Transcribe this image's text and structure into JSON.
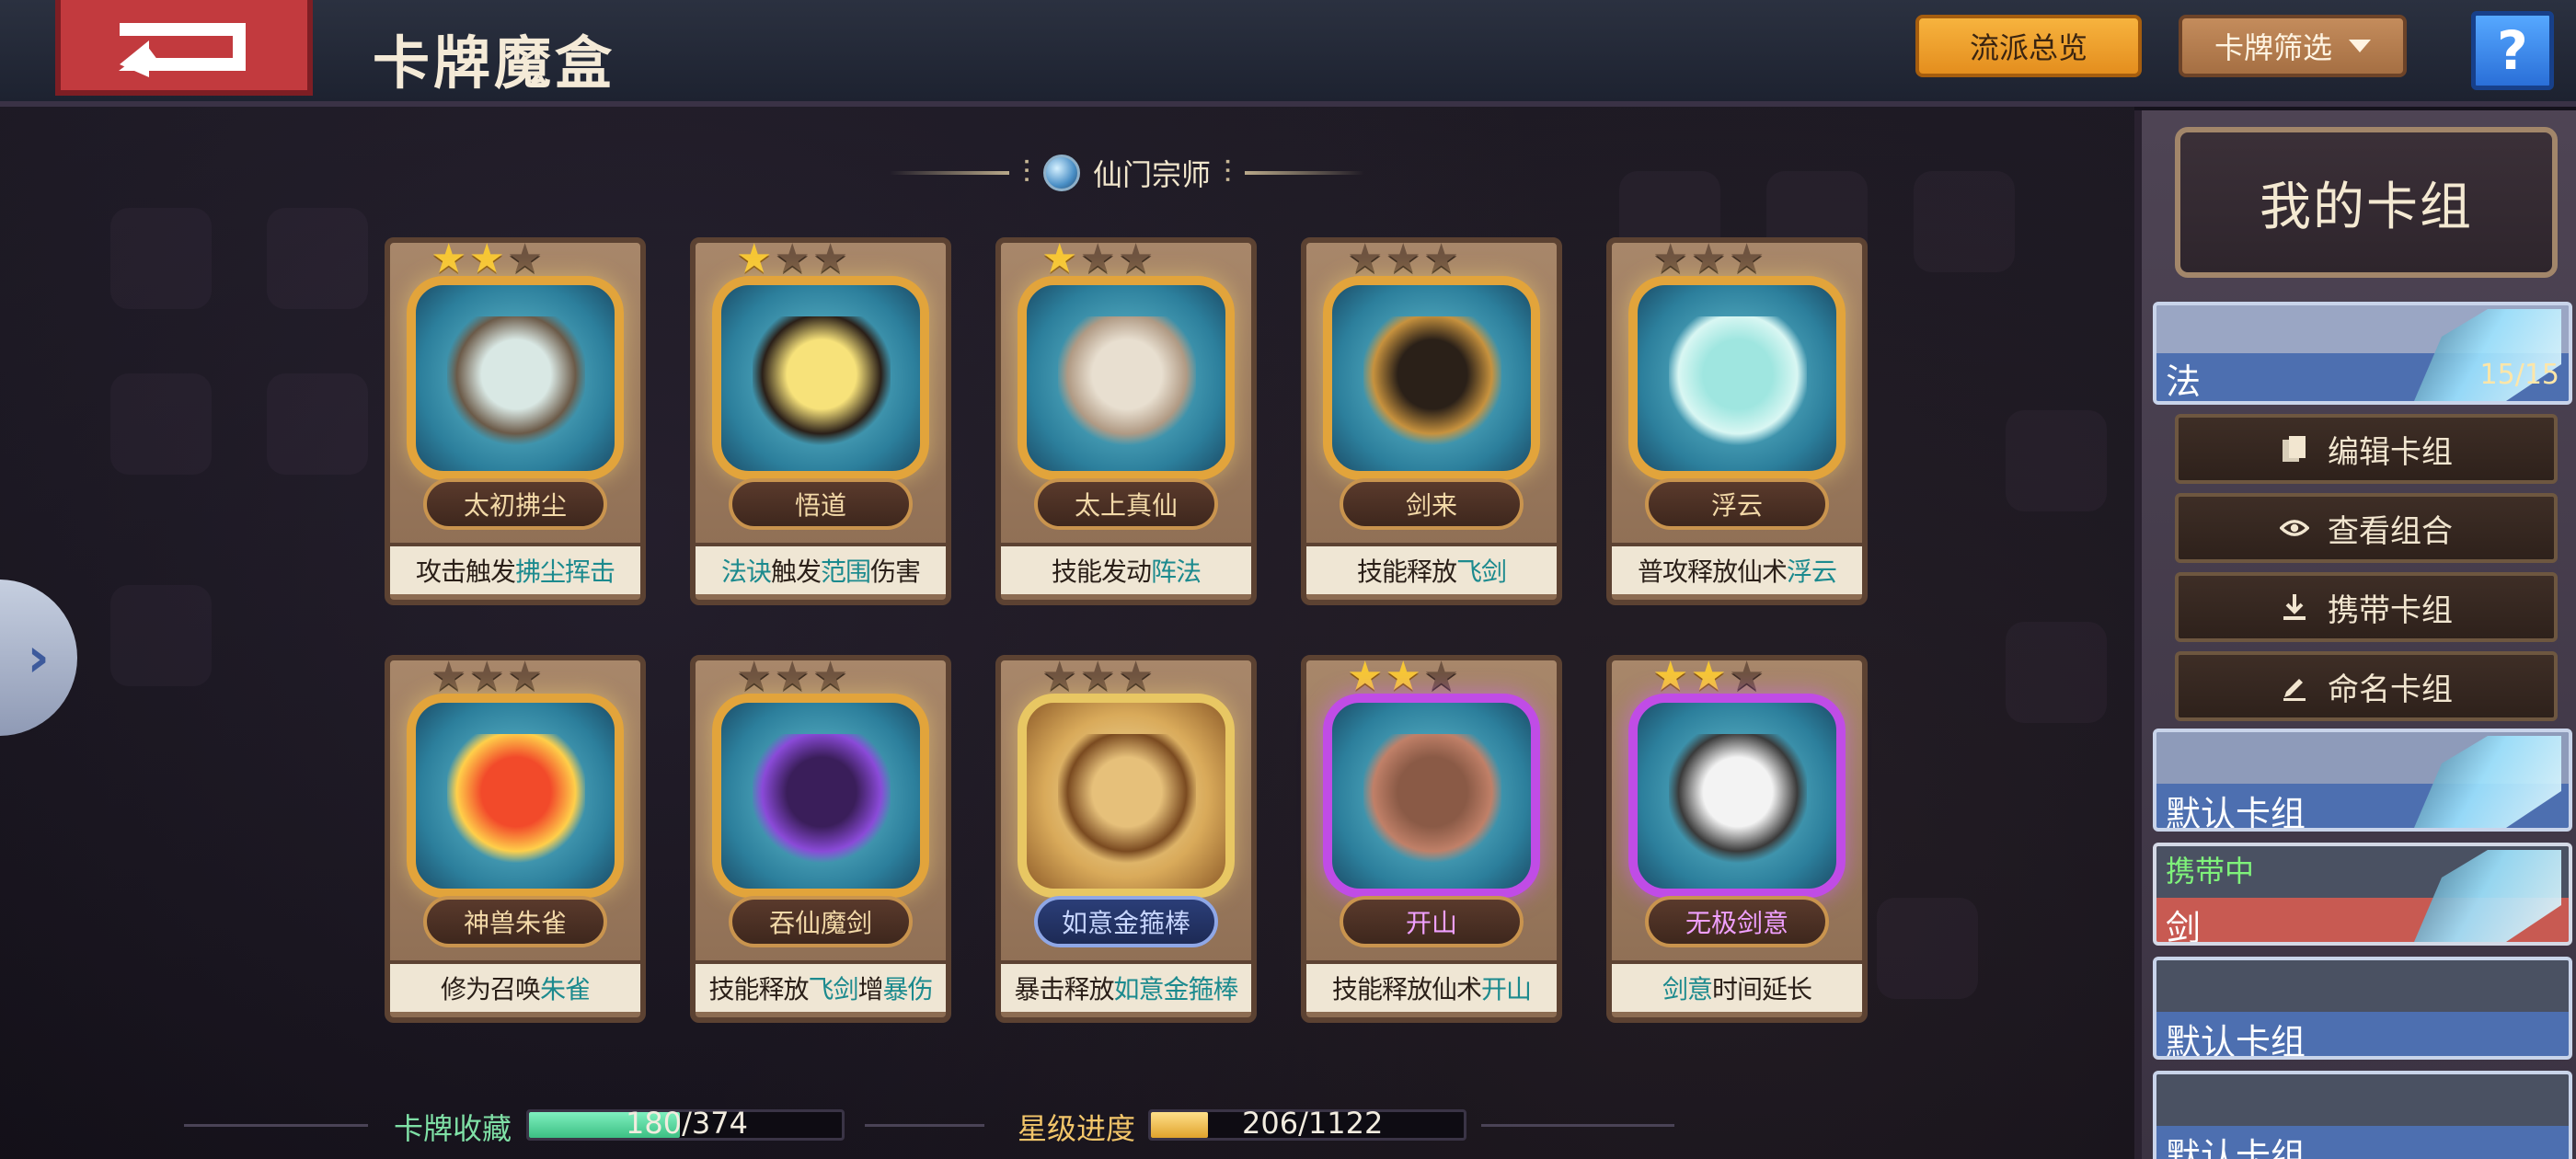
{
  "header": {
    "title": "卡牌魔盒",
    "overview_button": "流派总览",
    "filter_button": "卡牌筛选",
    "help_button": "?"
  },
  "section": {
    "title": "仙门宗师"
  },
  "cards": [
    {
      "name": "太初拂尘",
      "desc_pre": "攻击触发",
      "desc_hl": "拂尘挥击",
      "desc_post": "",
      "stars": 2,
      "style": "gold"
    },
    {
      "name": "悟道",
      "desc_pre": "",
      "desc_hl": "法诀",
      "desc_post": "触发",
      "desc_hl2": "范围",
      "desc_post2": "伤害",
      "stars": 1,
      "style": "gold"
    },
    {
      "name": "太上真仙",
      "desc_pre": "技能发动",
      "desc_hl": "阵法",
      "desc_post": "",
      "stars": 1,
      "style": "gold"
    },
    {
      "name": "剑来",
      "desc_pre": "技能释放",
      "desc_hl": "飞剑",
      "desc_post": "",
      "stars": 0,
      "style": "gold"
    },
    {
      "name": "浮云",
      "desc_pre": "普攻释放仙术",
      "desc_hl": "浮云",
      "desc_post": "",
      "stars": 0,
      "style": "gold"
    },
    {
      "name": "神兽朱雀",
      "desc_pre": "修为召唤",
      "desc_hl": "朱雀",
      "desc_post": "",
      "stars": 0,
      "style": "gold"
    },
    {
      "name": "吞仙魔剑",
      "desc_pre": "技能释放",
      "desc_hl": "飞剑",
      "desc_post": "增",
      "desc_hl2": "暴伤",
      "desc_post2": "",
      "stars": 0,
      "style": "gold"
    },
    {
      "name": "如意金箍棒",
      "desc_pre": "暴击释放",
      "desc_hl": "如意金箍棒",
      "desc_post": "",
      "stars": 0,
      "style": "ornate"
    },
    {
      "name": "开山",
      "desc_pre": "技能释放仙术",
      "desc_hl": "开山",
      "desc_post": "",
      "stars": 2,
      "style": "purple"
    },
    {
      "name": "无极剑意",
      "desc_pre": "",
      "desc_hl": "剑意",
      "desc_post": "时间延长",
      "stars": 2,
      "style": "purple"
    }
  ],
  "progress": {
    "collection_label": "卡牌收藏",
    "collection_text": "180/374",
    "collection_value": 180,
    "collection_total": 374,
    "star_label": "星级进度",
    "star_text": "206/1122",
    "star_value": 206,
    "star_total": 1122
  },
  "deck_panel": {
    "title": "我的卡组",
    "active_deck": {
      "label": "法",
      "count": "15/15"
    },
    "actions": [
      {
        "label": "编辑卡组",
        "icon": "cards-icon"
      },
      {
        "label": "查看组合",
        "icon": "eye-icon"
      },
      {
        "label": "携带卡组",
        "icon": "download-icon"
      },
      {
        "label": "命名卡组",
        "icon": "pencil-icon"
      }
    ],
    "decks": [
      {
        "label": "默认卡组",
        "tag": ""
      },
      {
        "label": "剑",
        "tag": "携带中"
      },
      {
        "label": "默认卡组",
        "tag": ""
      },
      {
        "label": "默认卡组",
        "tag": ""
      }
    ]
  },
  "colors": {
    "accent_gold": "#f7b33e",
    "highlight_teal": "#1c8a8e",
    "collection_fill": "#4fd69a",
    "star_fill": "#f3c24a",
    "deck_blue": "#4d6fb0",
    "deck_red": "#c85a52"
  }
}
